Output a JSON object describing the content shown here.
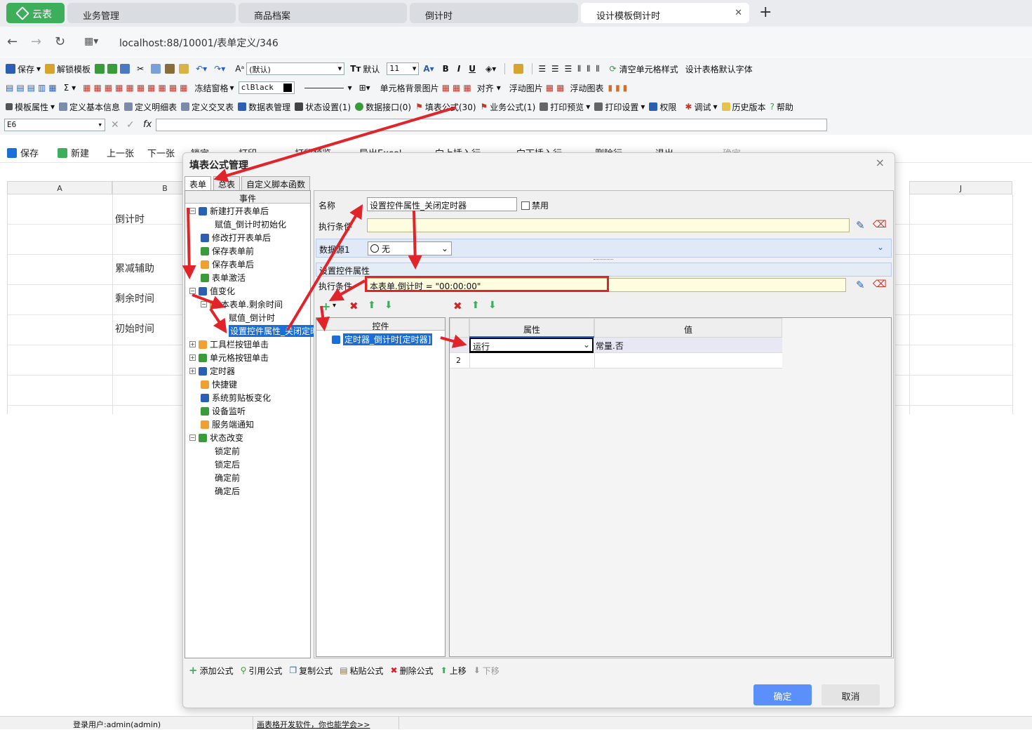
{
  "browser": {
    "logo_label": "云表",
    "tabs": [
      {
        "label": "业务管理"
      },
      {
        "label": "商品档案"
      },
      {
        "label": "倒计时"
      },
      {
        "label": "设计模板倒计时"
      }
    ],
    "close_glyph": "✕",
    "new_tab_glyph": "+",
    "url": "localhost:88/10001/表单定义/346"
  },
  "toolbar": {
    "row1": {
      "save": "保存",
      "unlock": "解锁模板",
      "font_combo": "(默认)",
      "font_t": "默认",
      "size": "11",
      "clear_style": "清空单元格样式",
      "default_font": "设计表格默认字体"
    },
    "row2": {
      "freeze": "冻结窗格",
      "color_combo": "clBlack",
      "cell_bg": "单元格背景图片",
      "align": "对齐",
      "float_img": "浮动图片",
      "float_chart": "浮动图表"
    },
    "row3": {
      "tpl_prop": "模板属性",
      "def_basic": "定义基本信息",
      "def_detail": "定义明细表",
      "def_cross": "定义交叉表",
      "datasheet": "数据表管理",
      "state": "状态设置(1)",
      "data_iface": "数据接口(0)",
      "fill_formula": "填表公式(30)",
      "biz_formula": "业务公式(1)",
      "print_preview": "打印预览",
      "print_setup": "打印设置",
      "perm": "权限",
      "debug": "调试",
      "history": "历史版本",
      "help": "帮助"
    },
    "cellref": "E6"
  },
  "appbar": {
    "save": "保存",
    "new": "新建",
    "prev": "上一张",
    "next": "下一张",
    "lock": "锁定",
    "print": "打印",
    "print_preview": "打印预览",
    "export_excel": "导出Excel",
    "insert_above": "向上插入行",
    "insert_below": "向下插入行",
    "delete_row": "删除行",
    "exit": "退出",
    "confirm": "确定"
  },
  "sheet": {
    "col_a": "A",
    "col_b": "B",
    "col_j": "J",
    "rows": [
      "倒计时",
      "累减辅助",
      "剩余时间",
      "初始时间"
    ]
  },
  "dialog": {
    "title": "填表公式管理",
    "close": "×",
    "tabs": [
      "表单",
      "总表",
      "自定义脚本函数"
    ],
    "event_header": "事件",
    "tree": [
      {
        "label": "新建打开表单后",
        "level": 0,
        "exp": "−"
      },
      {
        "label": "赋值_倒计时初始化",
        "level": 1
      },
      {
        "label": "修改打开表单后",
        "level": 0
      },
      {
        "label": "保存表单前",
        "level": 0
      },
      {
        "label": "保存表单后",
        "level": 0
      },
      {
        "label": "表单激活",
        "level": 0
      },
      {
        "label": "值变化",
        "level": 0,
        "exp": "−"
      },
      {
        "label": "本表单.剩余时间",
        "level": 1,
        "exp": "−"
      },
      {
        "label": "赋值_倒计时",
        "level": 2
      },
      {
        "label": "设置控件属性_关闭定时器",
        "level": 2,
        "selected": true
      },
      {
        "label": "工具栏按钮单击",
        "level": 0,
        "exp": "+"
      },
      {
        "label": "单元格按钮单击",
        "level": 0,
        "exp": "+"
      },
      {
        "label": "定时器",
        "level": 0,
        "exp": "+"
      },
      {
        "label": "快捷键",
        "level": 0
      },
      {
        "label": "系统剪贴板变化",
        "level": 0
      },
      {
        "label": "设备监听",
        "level": 0
      },
      {
        "label": "服务端通知",
        "level": 0
      },
      {
        "label": "状态改变",
        "level": 0,
        "exp": "−"
      },
      {
        "label": "锁定前",
        "level": 1
      },
      {
        "label": "锁定后",
        "level": 1
      },
      {
        "label": "确定前",
        "level": 1
      },
      {
        "label": "确定后",
        "level": 1
      }
    ],
    "name_label": "名称",
    "name_value": "设置控件属性_关闭定时器",
    "disable_label": "禁用",
    "exec_cond_label": "执行条件",
    "datasource_label": "数据源1",
    "datasource_value": "无",
    "section_title": "设置控件属性",
    "exec_cond2_label": "执行条件",
    "exec_cond2_value": "本表单.倒计时 = \"00:00:00\"",
    "control_header": "控件",
    "control_item": "定时器_倒计时[定时器]",
    "prop_header": "属性",
    "value_header": "值",
    "prop_rows": [
      {
        "num": "",
        "prop": "运行",
        "value": "常量.否"
      },
      {
        "num": "2",
        "prop": "",
        "value": ""
      }
    ],
    "bottom_buttons": [
      "添加公式",
      "引用公式",
      "复制公式",
      "粘贴公式",
      "删除公式",
      "上移",
      "下移"
    ],
    "ok": "确定",
    "cancel": "取消"
  },
  "status": {
    "user": "登录用户:admin(admin)",
    "promo": "画表格开发软件，你也能学会>>"
  },
  "colors": {
    "accent": "#1a6ed8",
    "arrow": "#e0242a",
    "ok_button": "#5b8ff9",
    "logo": "#3daf5b"
  }
}
